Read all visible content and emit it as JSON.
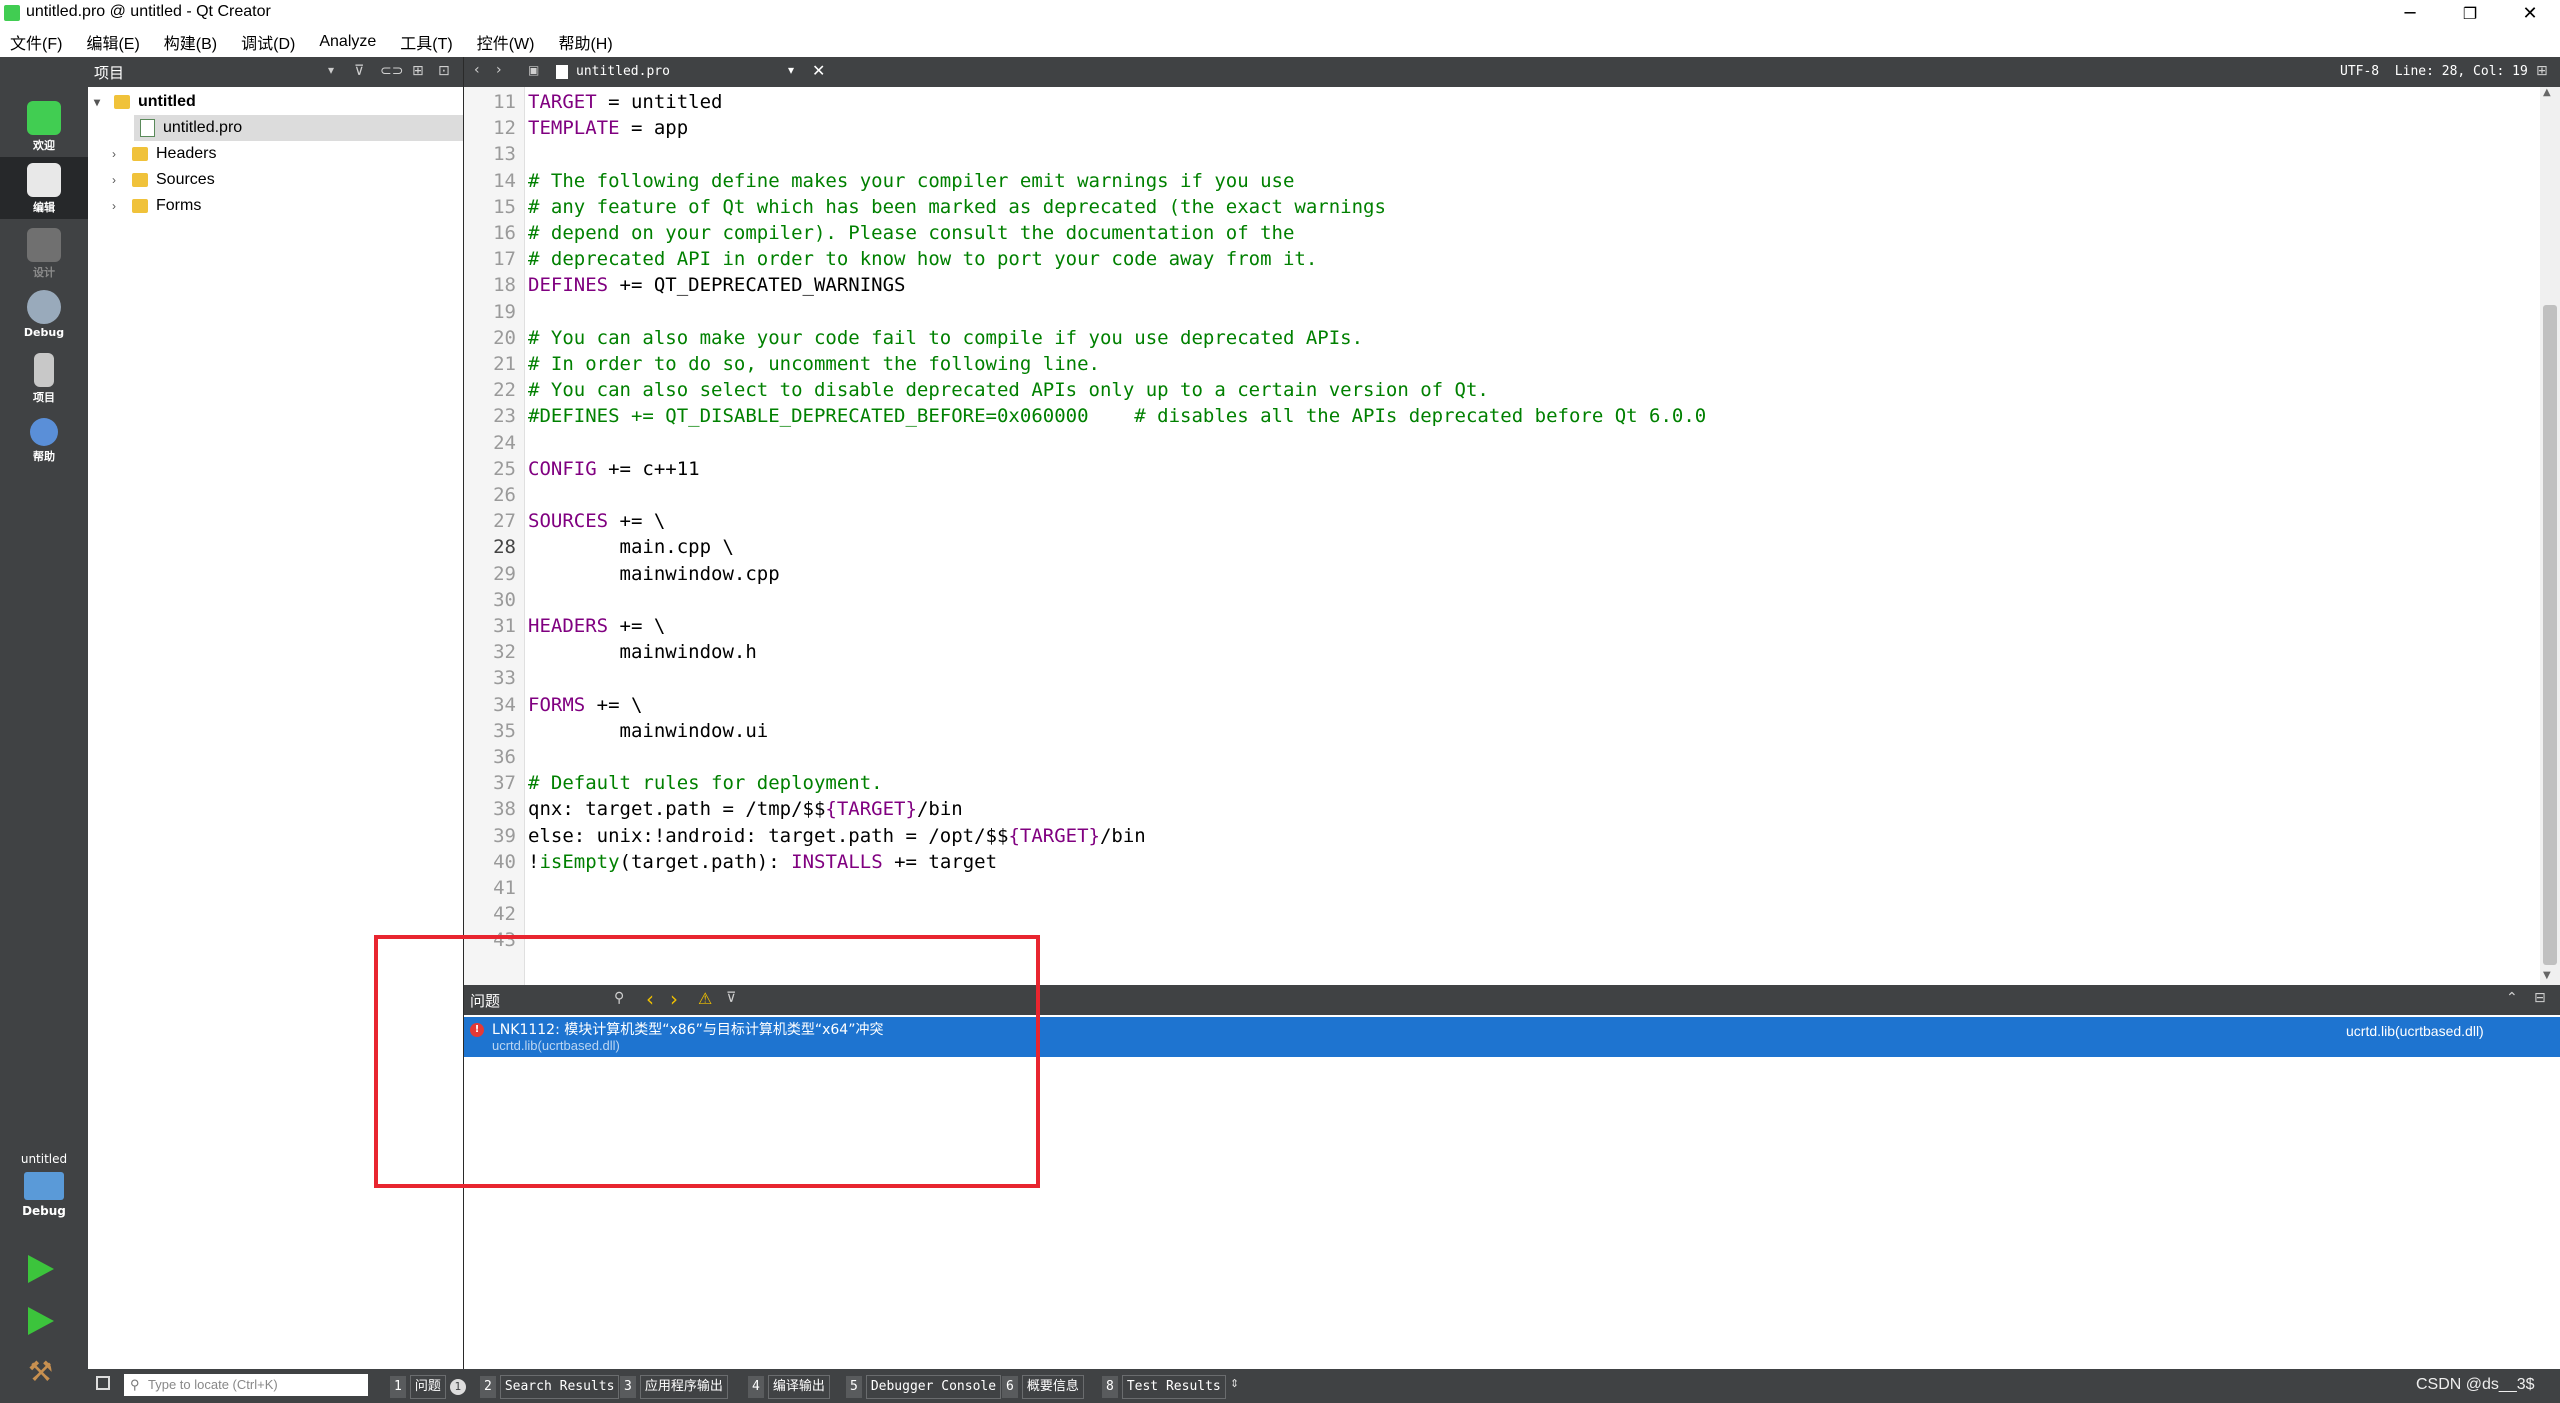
{
  "window": {
    "title": "untitled.pro @ untitled - Qt Creator",
    "minimize_glyph": "─",
    "restore_glyph": "❐",
    "close_glyph": "✕"
  },
  "menu": [
    "文件(F)",
    "编辑(E)",
    "构建(B)",
    "调试(D)",
    "Analyze",
    "工具(T)",
    "控件(W)",
    "帮助(H)"
  ],
  "modes": [
    {
      "label": "欢迎",
      "icon": "qt-logo-icon"
    },
    {
      "label": "编辑",
      "icon": "edit-doc-icon"
    },
    {
      "label": "设计",
      "icon": "design-icon"
    },
    {
      "label": "Debug",
      "icon": "debug-bug-icon"
    },
    {
      "label": "项目",
      "icon": "project-icon"
    },
    {
      "label": "帮助",
      "icon": "help-icon"
    }
  ],
  "kit": {
    "project": "untitled",
    "config": "Debug"
  },
  "project_pane": {
    "title": "项目",
    "tree": {
      "root": "untitled",
      "file": "untitled.pro",
      "folders": [
        "Headers",
        "Sources",
        "Forms"
      ]
    }
  },
  "editor": {
    "tab_file": "untitled.pro",
    "status": "UTF-8  Line: 28, Col: 19",
    "lines": [
      {
        "n": "11",
        "parts": [
          [
            "kw",
            "TARGET"
          ],
          [
            "tx",
            " = untitled"
          ]
        ]
      },
      {
        "n": "12",
        "parts": [
          [
            "kw",
            "TEMPLATE"
          ],
          [
            "tx",
            " = app"
          ]
        ]
      },
      {
        "n": "13",
        "parts": []
      },
      {
        "n": "14",
        "parts": [
          [
            "cm",
            "# The following define makes your compiler emit warnings if you use"
          ]
        ]
      },
      {
        "n": "15",
        "parts": [
          [
            "cm",
            "# any feature of Qt which has been marked as deprecated (the exact warnings"
          ]
        ]
      },
      {
        "n": "16",
        "parts": [
          [
            "cm",
            "# depend on your compiler). Please consult the documentation of the"
          ]
        ]
      },
      {
        "n": "17",
        "parts": [
          [
            "cm",
            "# deprecated API in order to know how to port your code away from it."
          ]
        ]
      },
      {
        "n": "18",
        "parts": [
          [
            "kw",
            "DEFINES"
          ],
          [
            "tx",
            " += QT_DEPRECATED_WARNINGS"
          ]
        ]
      },
      {
        "n": "19",
        "parts": []
      },
      {
        "n": "20",
        "parts": [
          [
            "cm",
            "# You can also make your code fail to compile if you use deprecated APIs."
          ]
        ]
      },
      {
        "n": "21",
        "parts": [
          [
            "cm",
            "# In order to do so, uncomment the following line."
          ]
        ]
      },
      {
        "n": "22",
        "parts": [
          [
            "cm",
            "# You can also select to disable deprecated APIs only up to a certain version of Qt."
          ]
        ]
      },
      {
        "n": "23",
        "parts": [
          [
            "cm",
            "#DEFINES += QT_DISABLE_DEPRECATED_BEFORE=0x060000    # disables all the APIs deprecated before Qt 6.0.0"
          ]
        ]
      },
      {
        "n": "24",
        "parts": []
      },
      {
        "n": "25",
        "parts": [
          [
            "kw",
            "CONFIG"
          ],
          [
            "tx",
            " += c++11"
          ]
        ]
      },
      {
        "n": "26",
        "parts": []
      },
      {
        "n": "27",
        "parts": [
          [
            "kw",
            "SOURCES"
          ],
          [
            "tx",
            " += \\"
          ]
        ]
      },
      {
        "n": "28",
        "parts": [
          [
            "tx",
            "        main.cpp \\"
          ]
        ]
      },
      {
        "n": "29",
        "parts": [
          [
            "tx",
            "        mainwindow.cpp"
          ]
        ]
      },
      {
        "n": "30",
        "parts": []
      },
      {
        "n": "31",
        "parts": [
          [
            "kw",
            "HEADERS"
          ],
          [
            "tx",
            " += \\"
          ]
        ]
      },
      {
        "n": "32",
        "parts": [
          [
            "tx",
            "        mainwindow.h"
          ]
        ]
      },
      {
        "n": "33",
        "parts": []
      },
      {
        "n": "34",
        "parts": [
          [
            "kw",
            "FORMS"
          ],
          [
            "tx",
            " += \\"
          ]
        ]
      },
      {
        "n": "35",
        "parts": [
          [
            "tx",
            "        mainwindow.ui"
          ]
        ]
      },
      {
        "n": "36",
        "parts": []
      },
      {
        "n": "37",
        "parts": [
          [
            "cm",
            "# Default rules for deployment."
          ]
        ]
      },
      {
        "n": "38",
        "parts": [
          [
            "tx",
            "qnx: target.path = /tmp/$$"
          ],
          [
            "kw",
            "{TARGET}"
          ],
          [
            "tx",
            "/bin"
          ]
        ]
      },
      {
        "n": "39",
        "parts": [
          [
            "tx",
            "else: unix:!android: target.path = /opt/$$"
          ],
          [
            "kw",
            "{TARGET}"
          ],
          [
            "tx",
            "/bin"
          ]
        ]
      },
      {
        "n": "40",
        "parts": [
          [
            "tx",
            "!"
          ],
          [
            "cm",
            "isEmpty"
          ],
          [
            "tx",
            "(target.path): "
          ],
          [
            "kw",
            "INSTALLS"
          ],
          [
            "tx",
            " += target"
          ]
        ]
      },
      {
        "n": "41",
        "parts": []
      },
      {
        "n": "42",
        "parts": []
      },
      {
        "n": "43",
        "parts": []
      }
    ]
  },
  "issues": {
    "title": "问题",
    "message": "LNK1112: 模块计算机类型“x86”与目标计算机类型“x64”冲突",
    "detail": "ucrtd.lib(ucrtbased.dll)",
    "location": "ucrtd.lib(ucrtbased.dll)"
  },
  "bottom": {
    "locate_placeholder": "Type to locate (Ctrl+K)",
    "tabs": [
      {
        "n": "1",
        "label": "问题",
        "badge": "1"
      },
      {
        "n": "2",
        "label": "Search Results"
      },
      {
        "n": "3",
        "label": "应用程序输出"
      },
      {
        "n": "4",
        "label": "编译输出"
      },
      {
        "n": "5",
        "label": "Debugger Console"
      },
      {
        "n": "6",
        "label": "概要信息"
      },
      {
        "n": "8",
        "label": "Test Results"
      }
    ],
    "watermark": "CSDN @ds__3$"
  },
  "colors": {
    "accent": "#1e74d0",
    "highlight_box": "#e8252f",
    "sidebar": "#404244"
  }
}
